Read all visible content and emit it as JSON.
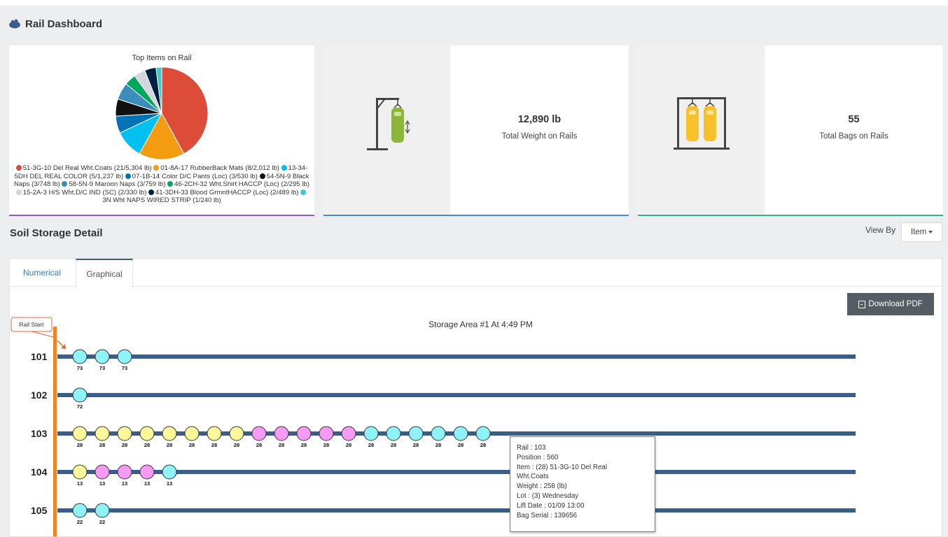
{
  "header": {
    "title": "Rail Dashboard"
  },
  "pie": {
    "title": "Top Items on Rail",
    "legend": [
      {
        "label": "51-3G-10 Del Real Wht.Coats (21/5,304 lb)",
        "color": "#dd4b39"
      },
      {
        "label": "01-8A-17 RubberBack Mats (8/2,012 lb)",
        "color": "#f39c12"
      },
      {
        "label": "13-34-5DH DEL REAL COLOR (5/1,237 lb)",
        "color": "#00c0ef"
      },
      {
        "label": "07-1B-14 Color D/C Pants (Loc) (3/530 lb)",
        "color": "#0073b7"
      },
      {
        "label": "54-5N-9 Black Naps (3/748 lb)",
        "color": "#111111"
      },
      {
        "label": "58-5N-9 Maroon Naps (3/759 lb)",
        "color": "#3c8dbc"
      },
      {
        "label": "46-2CH-32 Wht.Shirt HACCP (Loc) (2/295 lb)",
        "color": "#00a65a"
      },
      {
        "label": "15-2A-3 H/S Wht.D/C IND (SC) (2/330 lb)",
        "color": "#d2d6de"
      },
      {
        "label": "41-3DH-33 Blood GrmntHACCP (Loc) (2/489 lb)",
        "color": "#001f3f"
      },
      {
        "label": "3N Wht NAPS WIRED STRIP (1/240 lb)",
        "color": "#39cccc"
      }
    ]
  },
  "chart_data": {
    "type": "pie",
    "title": "Top Items on Rail",
    "labels": [
      "51-3G-10 Del Real Wht.Coats",
      "01-8A-17 RubberBack Mats",
      "13-34-5DH DEL REAL COLOR",
      "07-1B-14 Color D/C Pants (Loc)",
      "54-5N-9 Black Naps",
      "58-5N-9 Maroon Naps",
      "46-2CH-32 Wht.Shirt HACCP (Loc)",
      "15-2A-3 H/S Wht.D/C IND (SC)",
      "41-3DH-33 Blood GrmntHACCP (Loc)",
      "3N Wht NAPS WIRED STRIP"
    ],
    "values": [
      21,
      8,
      5,
      3,
      3,
      3,
      2,
      2,
      2,
      1
    ],
    "weights_lb": [
      5304,
      2012,
      1237,
      530,
      748,
      759,
      295,
      330,
      489,
      240
    ],
    "colors": [
      "#dd4b39",
      "#f39c12",
      "#00c0ef",
      "#0073b7",
      "#111111",
      "#3c8dbc",
      "#00a65a",
      "#d2d6de",
      "#001f3f",
      "#39cccc"
    ]
  },
  "stats": {
    "weight": {
      "value": "12,890 lb",
      "label": "Total Weight on Rails",
      "icon": "single-bag-hanger-icon"
    },
    "bags": {
      "value": "55",
      "label": "Total Bags on Rails",
      "icon": "double-bag-hanger-icon"
    }
  },
  "detail": {
    "title": "Soil Storage Detail",
    "view_by_label": "View By",
    "view_by_value": "Item",
    "tabs": [
      "Numerical",
      "Graphical"
    ],
    "active_tab": "Graphical",
    "download_label": "Download PDF",
    "storage_title": "Storage Area #1 At 4:49 PM",
    "rail_start_label": "Rail Start",
    "colors": {
      "cyan": "#8ff3f6",
      "yellow": "#fbf79a",
      "magenta": "#f79af6",
      "rail": "#3a5e8c",
      "start": "#f58220"
    },
    "rails": [
      {
        "id": "101",
        "bags": [
          {
            "c": "cyan",
            "n": "73"
          },
          {
            "c": "cyan",
            "n": "73"
          },
          {
            "c": "cyan",
            "n": "73"
          }
        ]
      },
      {
        "id": "102",
        "bags": [
          {
            "c": "cyan",
            "n": "72"
          }
        ]
      },
      {
        "id": "103",
        "bags": [
          {
            "c": "yellow",
            "n": "28"
          },
          {
            "c": "yellow",
            "n": "28"
          },
          {
            "c": "yellow",
            "n": "28"
          },
          {
            "c": "yellow",
            "n": "28"
          },
          {
            "c": "yellow",
            "n": "28"
          },
          {
            "c": "yellow",
            "n": "28"
          },
          {
            "c": "yellow",
            "n": "28"
          },
          {
            "c": "yellow",
            "n": "28"
          },
          {
            "c": "magenta",
            "n": "28"
          },
          {
            "c": "magenta",
            "n": "28"
          },
          {
            "c": "magenta",
            "n": "28"
          },
          {
            "c": "magenta",
            "n": "28"
          },
          {
            "c": "magenta",
            "n": "28"
          },
          {
            "c": "cyan",
            "n": "28"
          },
          {
            "c": "cyan",
            "n": "28"
          },
          {
            "c": "cyan",
            "n": "28"
          },
          {
            "c": "cyan",
            "n": "28"
          },
          {
            "c": "cyan",
            "n": "28"
          },
          {
            "c": "cyan",
            "n": "28"
          }
        ]
      },
      {
        "id": "104",
        "bags": [
          {
            "c": "yellow",
            "n": "13"
          },
          {
            "c": "magenta",
            "n": "13"
          },
          {
            "c": "magenta",
            "n": "13"
          },
          {
            "c": "magenta",
            "n": "13"
          },
          {
            "c": "cyan",
            "n": "13"
          }
        ]
      },
      {
        "id": "105",
        "bags": [
          {
            "c": "cyan",
            "n": "22"
          },
          {
            "c": "cyan",
            "n": "22"
          }
        ]
      }
    ],
    "tooltip": {
      "lines": [
        "Rail : 103",
        "Position : 560",
        "Item : (28) 51-3G-10 Del Real",
        "Wht.Coats",
        "Weight : 258 (lb)",
        "Lot : (3) Wednesday",
        "Lift Date : 01/09 13:00",
        "Bag Serial : 139656"
      ]
    }
  }
}
